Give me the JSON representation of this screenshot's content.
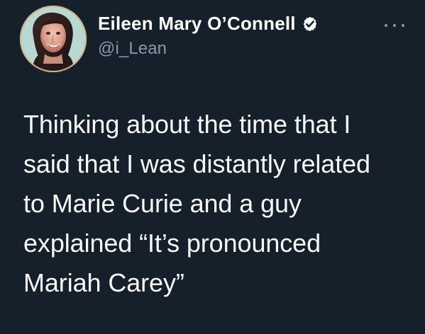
{
  "author": {
    "display_name": "Eileen Mary O’Connell",
    "handle": "@i_Lean",
    "verified_icon": "verified-badge-icon"
  },
  "tweet": {
    "lines": [
      "Thinking about the time that I",
      "said that I was distantly related",
      "to Marie Curie and a guy",
      "explained “It’s pronounced",
      "Mariah Carey”"
    ]
  },
  "ui": {
    "more_icon": "more-options-icon",
    "background_color": "#15202b",
    "text_color": "#f7f9f9",
    "secondary_text_color": "#8b98a5"
  }
}
